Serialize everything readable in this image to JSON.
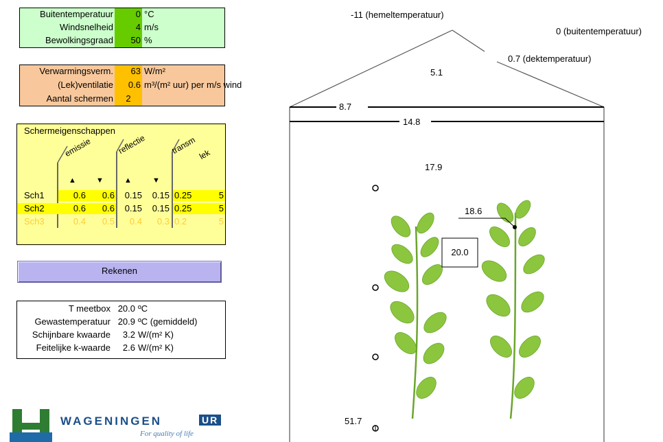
{
  "weather": {
    "rows": [
      {
        "label": "Buitentemperatuur",
        "value": "0",
        "unit": "°C"
      },
      {
        "label": "Windsnelheid",
        "value": "4",
        "unit": "m/s"
      },
      {
        "label": "Bewolkingsgraad",
        "value": "50",
        "unit": "%"
      }
    ],
    "bg": "#ccffcc",
    "value_bg": "#66cc00"
  },
  "heating": {
    "rows": [
      {
        "label": "Verwarmingsverm.",
        "value": "63",
        "unit": "W/m²"
      },
      {
        "label": "(Lek)ventilatie",
        "value": "0.6",
        "unit": "m³/(m² uur) per m/s wind"
      },
      {
        "label": "Aantal schermen",
        "value": "2",
        "unit": ""
      }
    ],
    "bg": "#f8c89c",
    "value_bg": "#ffc000"
  },
  "screens": {
    "title": "Schermeigenschappen",
    "group_headers": [
      "emissie",
      "reflectie",
      "transm",
      "lek"
    ],
    "arrows": [
      "▲",
      "▼",
      "▲",
      "▼"
    ],
    "rows": [
      {
        "name": "Sch1",
        "values": [
          "0.6",
          "0.6",
          "0.15",
          "0.15",
          "0.25",
          "5"
        ]
      },
      {
        "name": "Sch2",
        "values": [
          "0.6",
          "0.6",
          "0.15",
          "0.15",
          "0.25",
          "5"
        ]
      },
      {
        "name": "Sch3",
        "values": [
          "0.4",
          "0.5",
          "0.4",
          "0.3",
          "0.2",
          "5"
        ]
      }
    ],
    "bg": "#ffff99",
    "highlight": "#ffff00",
    "disabled_color": "#ffcc33"
  },
  "calc_button": {
    "label": "Rekenen"
  },
  "results": {
    "rows": [
      {
        "label": "T meetbox",
        "value": "20.0",
        "unit": "ºC"
      },
      {
        "label": "Gewastemperatuur",
        "value": "20.9",
        "unit": "ºC (gemiddeld)"
      },
      {
        "label": "Schijnbare kwaarde",
        "value": "3.2",
        "unit": "W/(m² K)"
      },
      {
        "label": "Feitelijke k-waarde",
        "value": "2.6",
        "unit": "W/(m² K)"
      }
    ]
  },
  "logo": {
    "word": "WAGENINGEN",
    "badge": "UR",
    "tagline": "For quality of life"
  },
  "diagram": {
    "sky_temp": "-11 (hemeltemperatuur)",
    "outside_temp": "0 (buitentemperatuur)",
    "cover_temp": "0.7 (dektemperatuur)",
    "roof_air": "5.1",
    "screen1": "8.7",
    "screen2": "14.8",
    "air": "17.9",
    "leaf": "18.6",
    "box": "20.0",
    "soil": "51.7"
  }
}
